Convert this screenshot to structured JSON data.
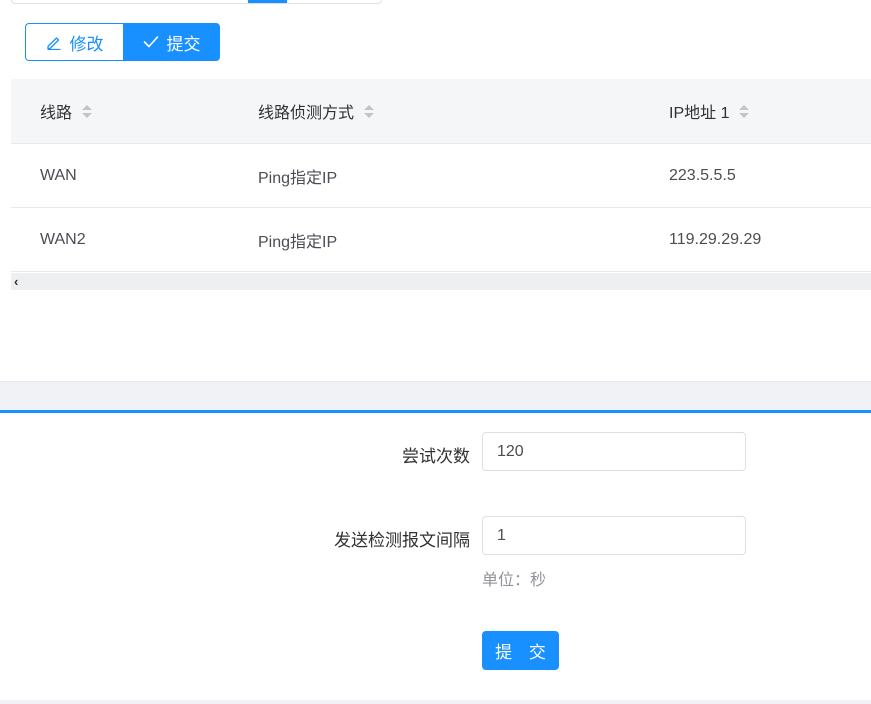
{
  "toolbar": {
    "edit_label": "修改",
    "submit_label": "提交"
  },
  "table": {
    "columns": [
      "线路",
      "线路侦测方式",
      "IP地址 1"
    ],
    "rows": [
      [
        "WAN",
        "Ping指定IP",
        "223.5.5.5"
      ],
      [
        "WAN2",
        "Ping指定IP",
        "119.29.29.29"
      ]
    ]
  },
  "form": {
    "retry_label": "尝试次数",
    "retry_value": "120",
    "interval_label": "发送检测报文间隔",
    "interval_value": "1",
    "interval_hint": "单位：秒",
    "submit_label": "提 交"
  },
  "colors": {
    "primary": "#1890ff"
  },
  "icons": {
    "edit": "edit-icon",
    "check": "check-icon",
    "sort": "sort-icon",
    "scroll_left": "chevron-left-icon"
  }
}
